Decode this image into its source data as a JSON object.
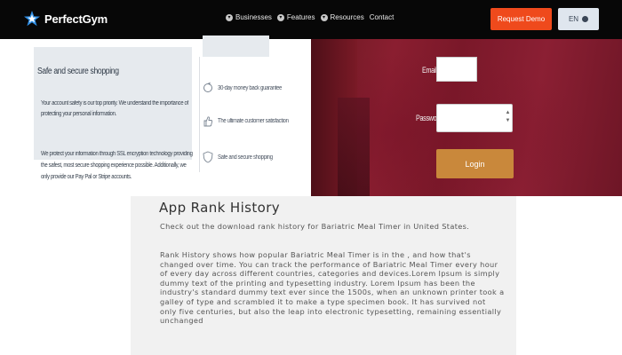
{
  "brand": {
    "name": "PerfectGym"
  },
  "nav": {
    "links": [
      {
        "label": "Businesses",
        "icon": "chevron-down-icon"
      },
      {
        "label": "Features",
        "icon": "chevron-down-icon"
      },
      {
        "label": "Resources",
        "icon": "chevron-down-icon"
      },
      {
        "label": "Contact"
      }
    ],
    "demo_label": "Request Demo",
    "lang_label": "EN"
  },
  "info": {
    "title": "Safe and secure shopping",
    "p1": "Your account safety is our top priority. We understand the importance of protecting your personal information.",
    "p2": "We protect your information through SSL encryption technology providing the safest, most secure shopping experience possible. Additionally, we only provide our Pay Pal or Stripe accounts."
  },
  "features": [
    {
      "label": "30-day money back guarantee",
      "icon": "refresh-icon"
    },
    {
      "label": "The ultimate customer satisfaction",
      "icon": "thumb-icon"
    },
    {
      "label": "Safe and secure shopping",
      "icon": "shield-icon"
    }
  ],
  "login": {
    "email_label": "Email",
    "password_label": "Password",
    "email_value": "",
    "password_value": "",
    "submit_label": "Login"
  },
  "rank": {
    "title": "App Rank History",
    "p1": "Check out the download rank history for Bariatric Meal Timer in United States.",
    "p2": "Rank History shows how popular Bariatric Meal Timer is in the , and how that's changed over time. You can track the performance of Bariatric Meal Timer every hour of every day across different countries, categories and devices.Lorem Ipsum is simply dummy text of the printing and typesetting industry. Lorem Ipsum has been the industry's standard dummy text ever since the 1500s, when an unknown printer took a galley of type and scrambled it to make a type specimen book. It has survived not only five centuries, but also the leap into electronic typesetting, remaining essentially unchanged"
  },
  "colors": {
    "nav_bg": "#070707",
    "accent": "#ef4a1c",
    "login_button": "#c9883b",
    "login_bg": "#7a1829"
  }
}
